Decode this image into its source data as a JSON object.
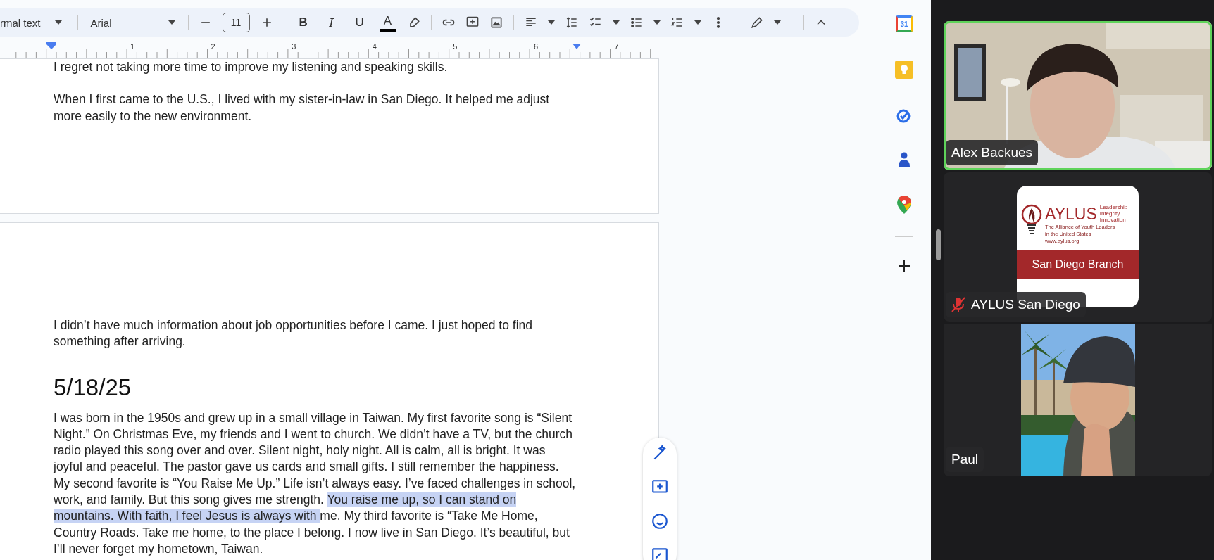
{
  "toolbar": {
    "style": "rmal text",
    "font": "Arial",
    "font_size": "11",
    "format_buttons": [
      {
        "label": "B",
        "kind": "bold"
      },
      {
        "label": "I",
        "kind": "italic"
      },
      {
        "label": "U",
        "kind": "underline"
      },
      {
        "label": "A",
        "kind": "color"
      }
    ]
  },
  "ruler": {
    "marks": [
      "1",
      "2",
      "3",
      "4",
      "5",
      "6",
      "7"
    ]
  },
  "pages": [
    {
      "blocks": [
        {
          "kind": "paragraph",
          "segments": [
            {
              "text": "I regret not taking more time to improve my listening and speaking skills.",
              "highlighted": false
            }
          ]
        },
        {
          "kind": "paragraph",
          "segments": [
            {
              "text": "When I first came to the U.S., I lived with my sister-in-law in San Diego. It helped me adjust\nmore easily to the new environment.",
              "highlighted": false
            }
          ]
        }
      ]
    },
    {
      "blocks": [
        {
          "kind": "paragraph",
          "segments": [
            {
              "text": "I didn’t have much information about job opportunities before I came. I just hoped to find\nsomething after arriving.",
              "highlighted": false
            }
          ]
        },
        {
          "kind": "heading",
          "segments": [
            {
              "text": "5/18/25",
              "highlighted": false
            }
          ]
        },
        {
          "kind": "paragraph",
          "segments": [
            {
              "text": "I was born in the 1950s and grew up in a small village in Taiwan. My first favorite song is “Silent\nNight.” On Christmas Eve, my friends and I went to church. We didn’t have a TV, but the church\nradio played this song over and over. Silent night, holy night. All is calm, all is bright. It was\njoyful and peaceful. The pastor gave us cards and small gifts. I still remember the happiness.\nMy second favorite is “You Raise Me Up.” Life isn’t always easy. I’ve faced challenges in school,\nwork, and family. But this song gives me strength. ",
              "highlighted": false
            },
            {
              "text": "You raise me up, so I can stand on\nmountains. With faith, I feel Jesus is always with ",
              "highlighted": true
            },
            {
              "text": "me. My third favorite is “Take Me Home,\nCountry Roads. Take me home, to the place I belong. I now live in San Diego. It’s beautiful, but\nI’ll never forget my hometown, Taiwan.",
              "highlighted": false
            }
          ]
        }
      ]
    }
  ],
  "side_panel": {
    "calendar_day": "31"
  },
  "participants": [
    {
      "name": "Alex Backues",
      "kind": "video",
      "speaking": true,
      "muted": false
    },
    {
      "name": "AYLUS San Diego",
      "kind": "logo",
      "speaking": false,
      "muted": true,
      "logo": {
        "title": "AYLUS",
        "motto": [
          "Leadership",
          "Integrity",
          "Innovation"
        ],
        "lines": [
          "The Alliance of Youth Leaders",
          "in the United States",
          "www.aylus.org"
        ],
        "branch": "San Diego Branch"
      }
    },
    {
      "name": "Paul",
      "kind": "video",
      "speaking": false,
      "muted": false
    }
  ]
}
